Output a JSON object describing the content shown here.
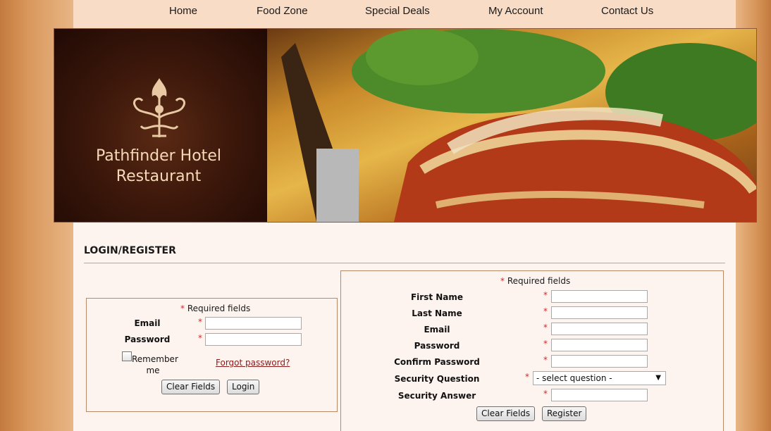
{
  "nav": {
    "items": [
      "Home",
      "Food Zone",
      "Special Deals",
      "My Account",
      "Contact Us"
    ]
  },
  "banner": {
    "title_line1": "Pathfinder Hotel",
    "title_line2": "Restaurant"
  },
  "section_title": "LOGIN/REGISTER",
  "login": {
    "required_note": "Required fields",
    "email_label": "Email",
    "password_label": "Password",
    "email_value": "",
    "password_value": "",
    "remember_line1": "Remember",
    "remember_line2": "me",
    "forgot_link": "Forgot password?",
    "clear_button": "Clear Fields",
    "login_button": "Login"
  },
  "register": {
    "required_note": "Required fields",
    "labels": {
      "first_name": "First Name",
      "last_name": "Last Name",
      "email": "Email",
      "password": "Password",
      "confirm_password": "Confirm Password",
      "security_question": "Security Question",
      "security_answer": "Security Answer"
    },
    "security_question_selected": "- select question -",
    "clear_button": "Clear Fields",
    "register_button": "Register"
  },
  "colors": {
    "star": "#d12a2a",
    "link": "#8b1a1a",
    "banner_text": "#f5d9b8"
  }
}
